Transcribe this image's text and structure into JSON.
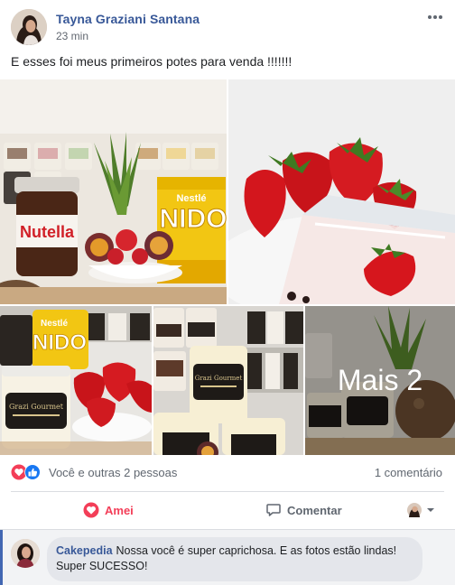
{
  "post": {
    "author": "Tayna Graziani Santana",
    "time": "23 min",
    "text": "E esses foi meus primeiros potes para venda !!!!!!!"
  },
  "photos": {
    "p1_labels": {
      "jar": "Nutella",
      "can_brand": "Nestlé",
      "can": "NIDO"
    },
    "p3_labels": {
      "can_brand": "Nestlé",
      "can": "NIDO",
      "pot": "Grazi Gourmet"
    },
    "more_label": "Mais 2"
  },
  "summary": {
    "reactions_text": "Você e outras 2 pessoas",
    "comments_text": "1 comentário"
  },
  "actions": {
    "love_label": "Amei",
    "comment_label": "Comentar"
  },
  "comment": {
    "author": "Cakepedia",
    "text": "Nossa você é super caprichosa. E as fotos estão lindas! Super SUCESSO!"
  },
  "colors": {
    "link_blue": "#385898",
    "love_red": "#f33e58",
    "like_blue": "#1877f2",
    "meta_gray": "#606770"
  },
  "icons": {
    "reactions": [
      "love-icon",
      "like-icon"
    ],
    "love_action": "heart-icon",
    "comment_action": "speech-bubble-icon",
    "more": "more-options-icon",
    "switch": "chevron-down-icon"
  }
}
